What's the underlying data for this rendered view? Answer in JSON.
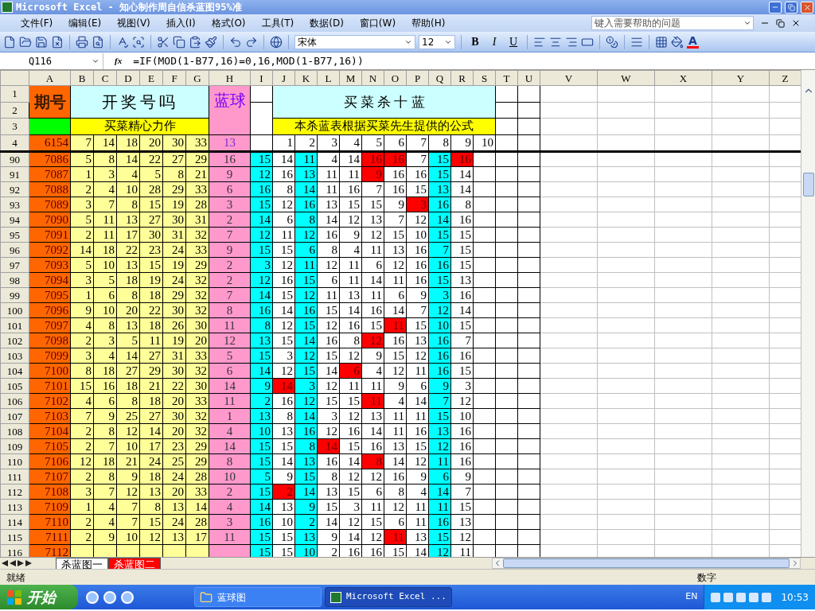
{
  "window": {
    "title": "Microsoft Excel - 知心制作周自信杀蓝图95%准"
  },
  "menu": [
    "文件(F)",
    "编辑(E)",
    "视图(V)",
    "插入(I)",
    "格式(O)",
    "工具(T)",
    "数据(D)",
    "窗口(W)",
    "帮助(H)"
  ],
  "help_box": {
    "placeholder": "键入需要帮助的问题"
  },
  "toolbar": {
    "font": "宋体",
    "size": "12",
    "format_buttons": [
      "B",
      "I",
      "U"
    ],
    "font_color_letter": "A"
  },
  "formula_bar": {
    "name_box": "Q116",
    "function_label": "fx",
    "formula": "=IF(MOD(1-B77,16)=0,16,MOD(1-B77,16))"
  },
  "columns": [
    "A",
    "B",
    "C",
    "D",
    "E",
    "F",
    "G",
    "H",
    "I",
    "J",
    "K",
    "L",
    "M",
    "N",
    "O",
    "P",
    "Q",
    "R",
    "S",
    "T",
    "U",
    "V",
    "W",
    "X",
    "Y",
    "Z"
  ],
  "header": {
    "row_labels": [
      "1",
      "2",
      "3",
      "4"
    ],
    "period_label": "期号",
    "draw_label": "开奖号吗",
    "blue_label": "蓝球",
    "kill_label": "买 菜 杀 十 蓝",
    "slogan": "买菜精心力作",
    "formula_note": "本杀蓝表根据买菜先生提供的公式",
    "period": "6154",
    "numbers": [
      "7",
      "14",
      "18",
      "20",
      "30",
      "33"
    ],
    "blue": "13",
    "indexes": [
      "1",
      "2",
      "3",
      "4",
      "5",
      "6",
      "7",
      "8",
      "9",
      "10"
    ]
  },
  "rows": [
    {
      "row": "90",
      "period": "7086",
      "numbers": [
        "5",
        "8",
        "14",
        "22",
        "27",
        "29"
      ],
      "blue": "16",
      "kill": [
        "15",
        "14",
        "11",
        "4",
        "14",
        "16",
        "16",
        "7",
        "15",
        "16"
      ],
      "hit": [
        false,
        false,
        false,
        false,
        false,
        true,
        true,
        false,
        false,
        true
      ]
    },
    {
      "row": "91",
      "period": "7087",
      "numbers": [
        "1",
        "3",
        "4",
        "5",
        "8",
        "21"
      ],
      "blue": "9",
      "kill": [
        "12",
        "16",
        "13",
        "11",
        "11",
        "9",
        "16",
        "16",
        "15",
        "14"
      ],
      "hit": [
        false,
        false,
        false,
        false,
        false,
        true,
        false,
        false,
        false,
        false
      ]
    },
    {
      "row": "92",
      "period": "7088",
      "numbers": [
        "2",
        "4",
        "10",
        "28",
        "29",
        "33"
      ],
      "blue": "6",
      "kill": [
        "16",
        "8",
        "14",
        "11",
        "16",
        "7",
        "16",
        "15",
        "13",
        "14"
      ],
      "hit": [
        false,
        false,
        false,
        false,
        false,
        false,
        false,
        false,
        false,
        false
      ]
    },
    {
      "row": "93",
      "period": "7089",
      "numbers": [
        "3",
        "7",
        "8",
        "15",
        "19",
        "28"
      ],
      "blue": "3",
      "kill": [
        "15",
        "12",
        "16",
        "13",
        "15",
        "15",
        "9",
        "3",
        "16",
        "8"
      ],
      "hit": [
        false,
        false,
        false,
        false,
        false,
        false,
        false,
        true,
        false,
        false
      ]
    },
    {
      "row": "94",
      "period": "7090",
      "numbers": [
        "5",
        "11",
        "13",
        "27",
        "30",
        "31"
      ],
      "blue": "2",
      "kill": [
        "14",
        "6",
        "8",
        "14",
        "12",
        "13",
        "7",
        "12",
        "14",
        "16"
      ],
      "hit": [
        false,
        false,
        false,
        false,
        false,
        false,
        false,
        false,
        false,
        false
      ]
    },
    {
      "row": "95",
      "period": "7091",
      "numbers": [
        "2",
        "11",
        "17",
        "30",
        "31",
        "32"
      ],
      "blue": "7",
      "kill": [
        "12",
        "11",
        "12",
        "16",
        "9",
        "12",
        "15",
        "10",
        "15",
        "15"
      ],
      "hit": [
        false,
        false,
        false,
        false,
        false,
        false,
        false,
        false,
        false,
        false
      ]
    },
    {
      "row": "96",
      "period": "7092",
      "numbers": [
        "14",
        "18",
        "22",
        "23",
        "24",
        "33"
      ],
      "blue": "9",
      "kill": [
        "15",
        "15",
        "6",
        "8",
        "4",
        "11",
        "13",
        "16",
        "7",
        "15"
      ],
      "hit": [
        false,
        false,
        false,
        false,
        false,
        false,
        false,
        false,
        false,
        false
      ]
    },
    {
      "row": "97",
      "period": "7093",
      "numbers": [
        "5",
        "10",
        "13",
        "15",
        "19",
        "29"
      ],
      "blue": "2",
      "kill": [
        "3",
        "12",
        "11",
        "12",
        "11",
        "6",
        "12",
        "16",
        "16",
        "15"
      ],
      "hit": [
        false,
        false,
        false,
        false,
        false,
        false,
        false,
        false,
        false,
        false
      ]
    },
    {
      "row": "98",
      "period": "7094",
      "numbers": [
        "3",
        "5",
        "18",
        "19",
        "24",
        "32"
      ],
      "blue": "2",
      "kill": [
        "12",
        "16",
        "15",
        "6",
        "11",
        "14",
        "11",
        "16",
        "15",
        "13"
      ],
      "hit": [
        false,
        false,
        false,
        false,
        false,
        false,
        false,
        false,
        false,
        false
      ]
    },
    {
      "row": "99",
      "period": "7095",
      "numbers": [
        "1",
        "6",
        "8",
        "18",
        "29",
        "32"
      ],
      "blue": "7",
      "kill": [
        "14",
        "15",
        "12",
        "11",
        "13",
        "11",
        "6",
        "9",
        "3",
        "16"
      ],
      "hit": [
        false,
        false,
        false,
        false,
        false,
        false,
        false,
        false,
        false,
        false
      ]
    },
    {
      "row": "100",
      "period": "7096",
      "numbers": [
        "9",
        "10",
        "20",
        "22",
        "30",
        "32"
      ],
      "blue": "8",
      "kill": [
        "16",
        "14",
        "16",
        "15",
        "14",
        "16",
        "14",
        "7",
        "12",
        "14"
      ],
      "hit": [
        false,
        false,
        false,
        false,
        false,
        false,
        false,
        false,
        false,
        false
      ]
    },
    {
      "row": "101",
      "period": "7097",
      "numbers": [
        "4",
        "8",
        "13",
        "18",
        "26",
        "30"
      ],
      "blue": "11",
      "kill": [
        "8",
        "12",
        "15",
        "12",
        "16",
        "15",
        "11",
        "15",
        "10",
        "15"
      ],
      "hit": [
        false,
        false,
        false,
        false,
        false,
        false,
        true,
        false,
        false,
        false
      ]
    },
    {
      "row": "102",
      "period": "7098",
      "numbers": [
        "2",
        "3",
        "5",
        "11",
        "19",
        "20"
      ],
      "blue": "12",
      "kill": [
        "13",
        "15",
        "14",
        "16",
        "8",
        "12",
        "16",
        "13",
        "16",
        "7"
      ],
      "hit": [
        false,
        false,
        false,
        false,
        false,
        true,
        false,
        false,
        false,
        false
      ]
    },
    {
      "row": "103",
      "period": "7099",
      "numbers": [
        "3",
        "4",
        "14",
        "27",
        "31",
        "33"
      ],
      "blue": "5",
      "kill": [
        "15",
        "3",
        "12",
        "15",
        "12",
        "9",
        "15",
        "12",
        "16",
        "16"
      ],
      "hit": [
        false,
        false,
        false,
        false,
        false,
        false,
        false,
        false,
        false,
        false
      ]
    },
    {
      "row": "104",
      "period": "7100",
      "numbers": [
        "8",
        "18",
        "27",
        "29",
        "30",
        "32"
      ],
      "blue": "6",
      "kill": [
        "14",
        "12",
        "15",
        "14",
        "6",
        "4",
        "12",
        "11",
        "16",
        "15"
      ],
      "hit": [
        false,
        false,
        false,
        false,
        true,
        false,
        false,
        false,
        false,
        false
      ]
    },
    {
      "row": "105",
      "period": "7101",
      "numbers": [
        "15",
        "16",
        "18",
        "21",
        "22",
        "30"
      ],
      "blue": "14",
      "kill": [
        "9",
        "14",
        "3",
        "12",
        "11",
        "11",
        "9",
        "6",
        "9",
        "3"
      ],
      "hit": [
        false,
        true,
        false,
        false,
        false,
        false,
        false,
        false,
        false,
        false
      ]
    },
    {
      "row": "106",
      "period": "7102",
      "numbers": [
        "4",
        "6",
        "8",
        "18",
        "20",
        "33"
      ],
      "blue": "11",
      "kill": [
        "2",
        "16",
        "12",
        "15",
        "15",
        "11",
        "4",
        "14",
        "7",
        "12"
      ],
      "hit": [
        false,
        false,
        false,
        false,
        false,
        true,
        false,
        false,
        false,
        false
      ]
    },
    {
      "row": "107",
      "period": "7103",
      "numbers": [
        "7",
        "9",
        "25",
        "27",
        "30",
        "32"
      ],
      "blue": "1",
      "kill": [
        "13",
        "8",
        "14",
        "3",
        "12",
        "13",
        "11",
        "11",
        "15",
        "10"
      ],
      "hit": [
        false,
        false,
        false,
        false,
        false,
        false,
        false,
        false,
        false,
        false
      ]
    },
    {
      "row": "108",
      "period": "7104",
      "numbers": [
        "2",
        "8",
        "12",
        "14",
        "20",
        "32"
      ],
      "blue": "4",
      "kill": [
        "10",
        "13",
        "16",
        "12",
        "16",
        "14",
        "11",
        "16",
        "13",
        "16"
      ],
      "hit": [
        false,
        false,
        false,
        false,
        false,
        false,
        false,
        false,
        false,
        false
      ]
    },
    {
      "row": "109",
      "period": "7105",
      "numbers": [
        "2",
        "7",
        "10",
        "17",
        "23",
        "29"
      ],
      "blue": "14",
      "kill": [
        "15",
        "15",
        "8",
        "14",
        "15",
        "16",
        "13",
        "15",
        "12",
        "16"
      ],
      "hit": [
        false,
        false,
        false,
        true,
        false,
        false,
        false,
        false,
        false,
        false
      ]
    },
    {
      "row": "110",
      "period": "7106",
      "numbers": [
        "12",
        "18",
        "21",
        "24",
        "25",
        "29"
      ],
      "blue": "8",
      "kill": [
        "15",
        "14",
        "13",
        "16",
        "14",
        "8",
        "14",
        "12",
        "11",
        "16"
      ],
      "hit": [
        false,
        false,
        false,
        false,
        false,
        true,
        false,
        false,
        false,
        false
      ]
    },
    {
      "row": "111",
      "period": "7107",
      "numbers": [
        "2",
        "8",
        "9",
        "18",
        "24",
        "28"
      ],
      "blue": "10",
      "kill": [
        "5",
        "9",
        "15",
        "8",
        "12",
        "12",
        "16",
        "9",
        "6",
        "9"
      ],
      "hit": [
        false,
        false,
        false,
        false,
        false,
        false,
        false,
        false,
        false,
        false
      ]
    },
    {
      "row": "112",
      "period": "7108",
      "numbers": [
        "3",
        "7",
        "12",
        "13",
        "20",
        "33"
      ],
      "blue": "2",
      "kill": [
        "15",
        "2",
        "14",
        "13",
        "15",
        "6",
        "8",
        "4",
        "14",
        "7"
      ],
      "hit": [
        false,
        true,
        false,
        false,
        false,
        false,
        false,
        false,
        false,
        false
      ]
    },
    {
      "row": "113",
      "period": "7109",
      "numbers": [
        "1",
        "4",
        "7",
        "8",
        "13",
        "14"
      ],
      "blue": "4",
      "kill": [
        "14",
        "13",
        "9",
        "15",
        "3",
        "11",
        "12",
        "11",
        "11",
        "15"
      ],
      "hit": [
        false,
        false,
        false,
        false,
        false,
        false,
        false,
        false,
        false,
        false
      ]
    },
    {
      "row": "114",
      "period": "7110",
      "numbers": [
        "2",
        "4",
        "7",
        "15",
        "24",
        "28"
      ],
      "blue": "3",
      "kill": [
        "16",
        "10",
        "2",
        "14",
        "12",
        "15",
        "6",
        "11",
        "16",
        "13"
      ],
      "hit": [
        false,
        false,
        false,
        false,
        false,
        false,
        false,
        false,
        false,
        false
      ]
    },
    {
      "row": "115",
      "period": "7111",
      "numbers": [
        "2",
        "9",
        "10",
        "12",
        "13",
        "17"
      ],
      "blue": "11",
      "kill": [
        "15",
        "15",
        "13",
        "9",
        "14",
        "12",
        "11",
        "13",
        "15",
        "12"
      ],
      "hit": [
        false,
        false,
        false,
        false,
        false,
        false,
        true,
        false,
        false,
        false
      ]
    },
    {
      "row": "116",
      "period": "7112",
      "kill": [
        "15",
        "15",
        "10",
        "2",
        "16",
        "16",
        "15",
        "14",
        "12",
        "11"
      ],
      "hit": [
        false,
        false,
        false,
        false,
        false,
        false,
        false,
        false,
        false,
        false
      ]
    }
  ],
  "sheet_tabs": [
    {
      "label": "杀蓝图一",
      "selected": true
    },
    {
      "label": "杀蓝图二",
      "selected": false,
      "color": "#ff0000"
    }
  ],
  "status_bar": {
    "left": "就绪",
    "mode": "数字"
  },
  "taskbar": {
    "start": "开始",
    "tasks": [
      {
        "label": "蓝球图",
        "selected": false,
        "kind": "folder"
      },
      {
        "label": "Microsoft Excel ...",
        "selected": true,
        "kind": "excel"
      }
    ],
    "language": "EN",
    "clock": "10:53"
  }
}
